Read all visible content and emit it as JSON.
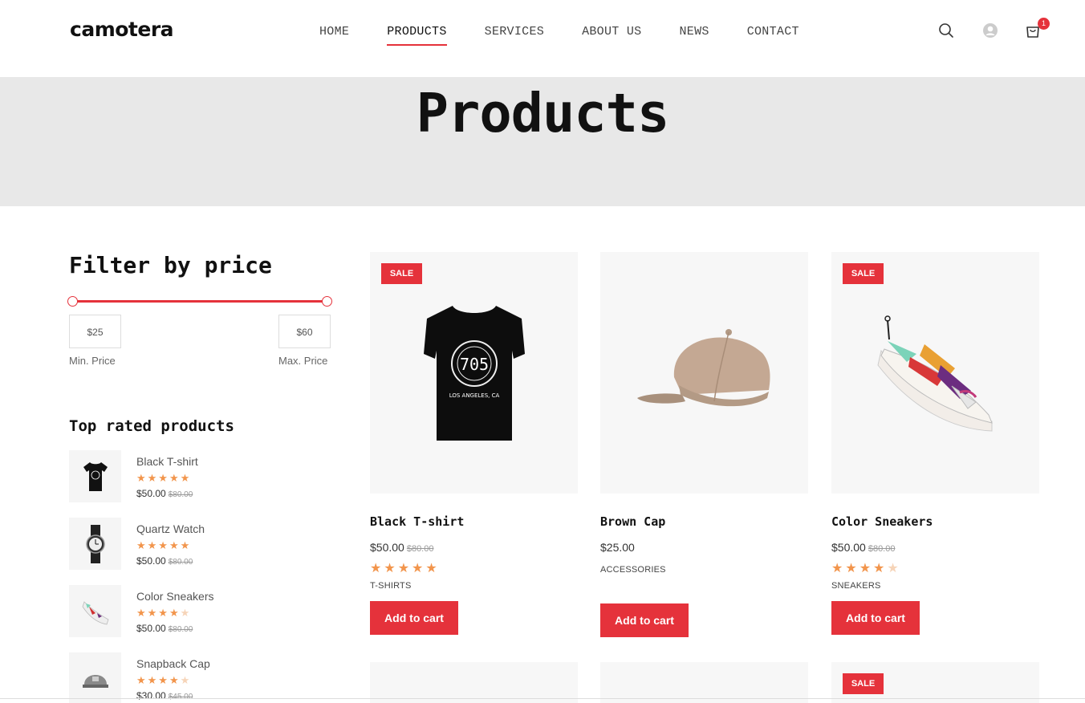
{
  "header": {
    "logo": "camotera",
    "nav": [
      "HOME",
      "PRODUCTS",
      "SERVICES",
      "ABOUT US",
      "NEWS",
      "CONTACT"
    ],
    "active_nav": "PRODUCTS",
    "cart_count": "1"
  },
  "banner": {
    "title": "Products"
  },
  "sidebar": {
    "filter_title": "Filter by price",
    "min_price": "$25",
    "max_price": "$60",
    "min_label": "Min. Price",
    "max_label": "Max. Price",
    "top_rated_title": "Top rated products",
    "top_rated": [
      {
        "name": "Black T-shirt",
        "rating": 5,
        "price": "$50.00",
        "old_price": "$80.00"
      },
      {
        "name": "Quartz Watch",
        "rating": 5,
        "price": "$50.00",
        "old_price": "$80.00"
      },
      {
        "name": "Color Sneakers",
        "rating": 4.5,
        "price": "$50.00",
        "old_price": "$80.00"
      },
      {
        "name": "Snapback Cap",
        "rating": 4,
        "price": "$30.00",
        "old_price": "$45.00"
      }
    ]
  },
  "products": [
    {
      "name": "Black T-shirt",
      "price": "$50.00",
      "old_price": "$80.00",
      "rating": 5,
      "category": "T-SHIRTS",
      "sale": "SALE",
      "button": "Add to cart"
    },
    {
      "name": "Brown Cap",
      "price": "$25.00",
      "old_price": "",
      "rating": 0,
      "category": "ACCESSORIES",
      "sale": "",
      "button": "Add to cart"
    },
    {
      "name": "Color Sneakers",
      "price": "$50.00",
      "old_price": "$80.00",
      "rating": 4.5,
      "category": "SNEAKERS",
      "sale": "SALE",
      "button": "Add to cart"
    }
  ],
  "row2_sale": "SALE",
  "colors": {
    "accent": "#e5323b",
    "star": "#f2954c",
    "banner_bg": "#e8e8e8",
    "card_bg": "#f7f7f7"
  }
}
